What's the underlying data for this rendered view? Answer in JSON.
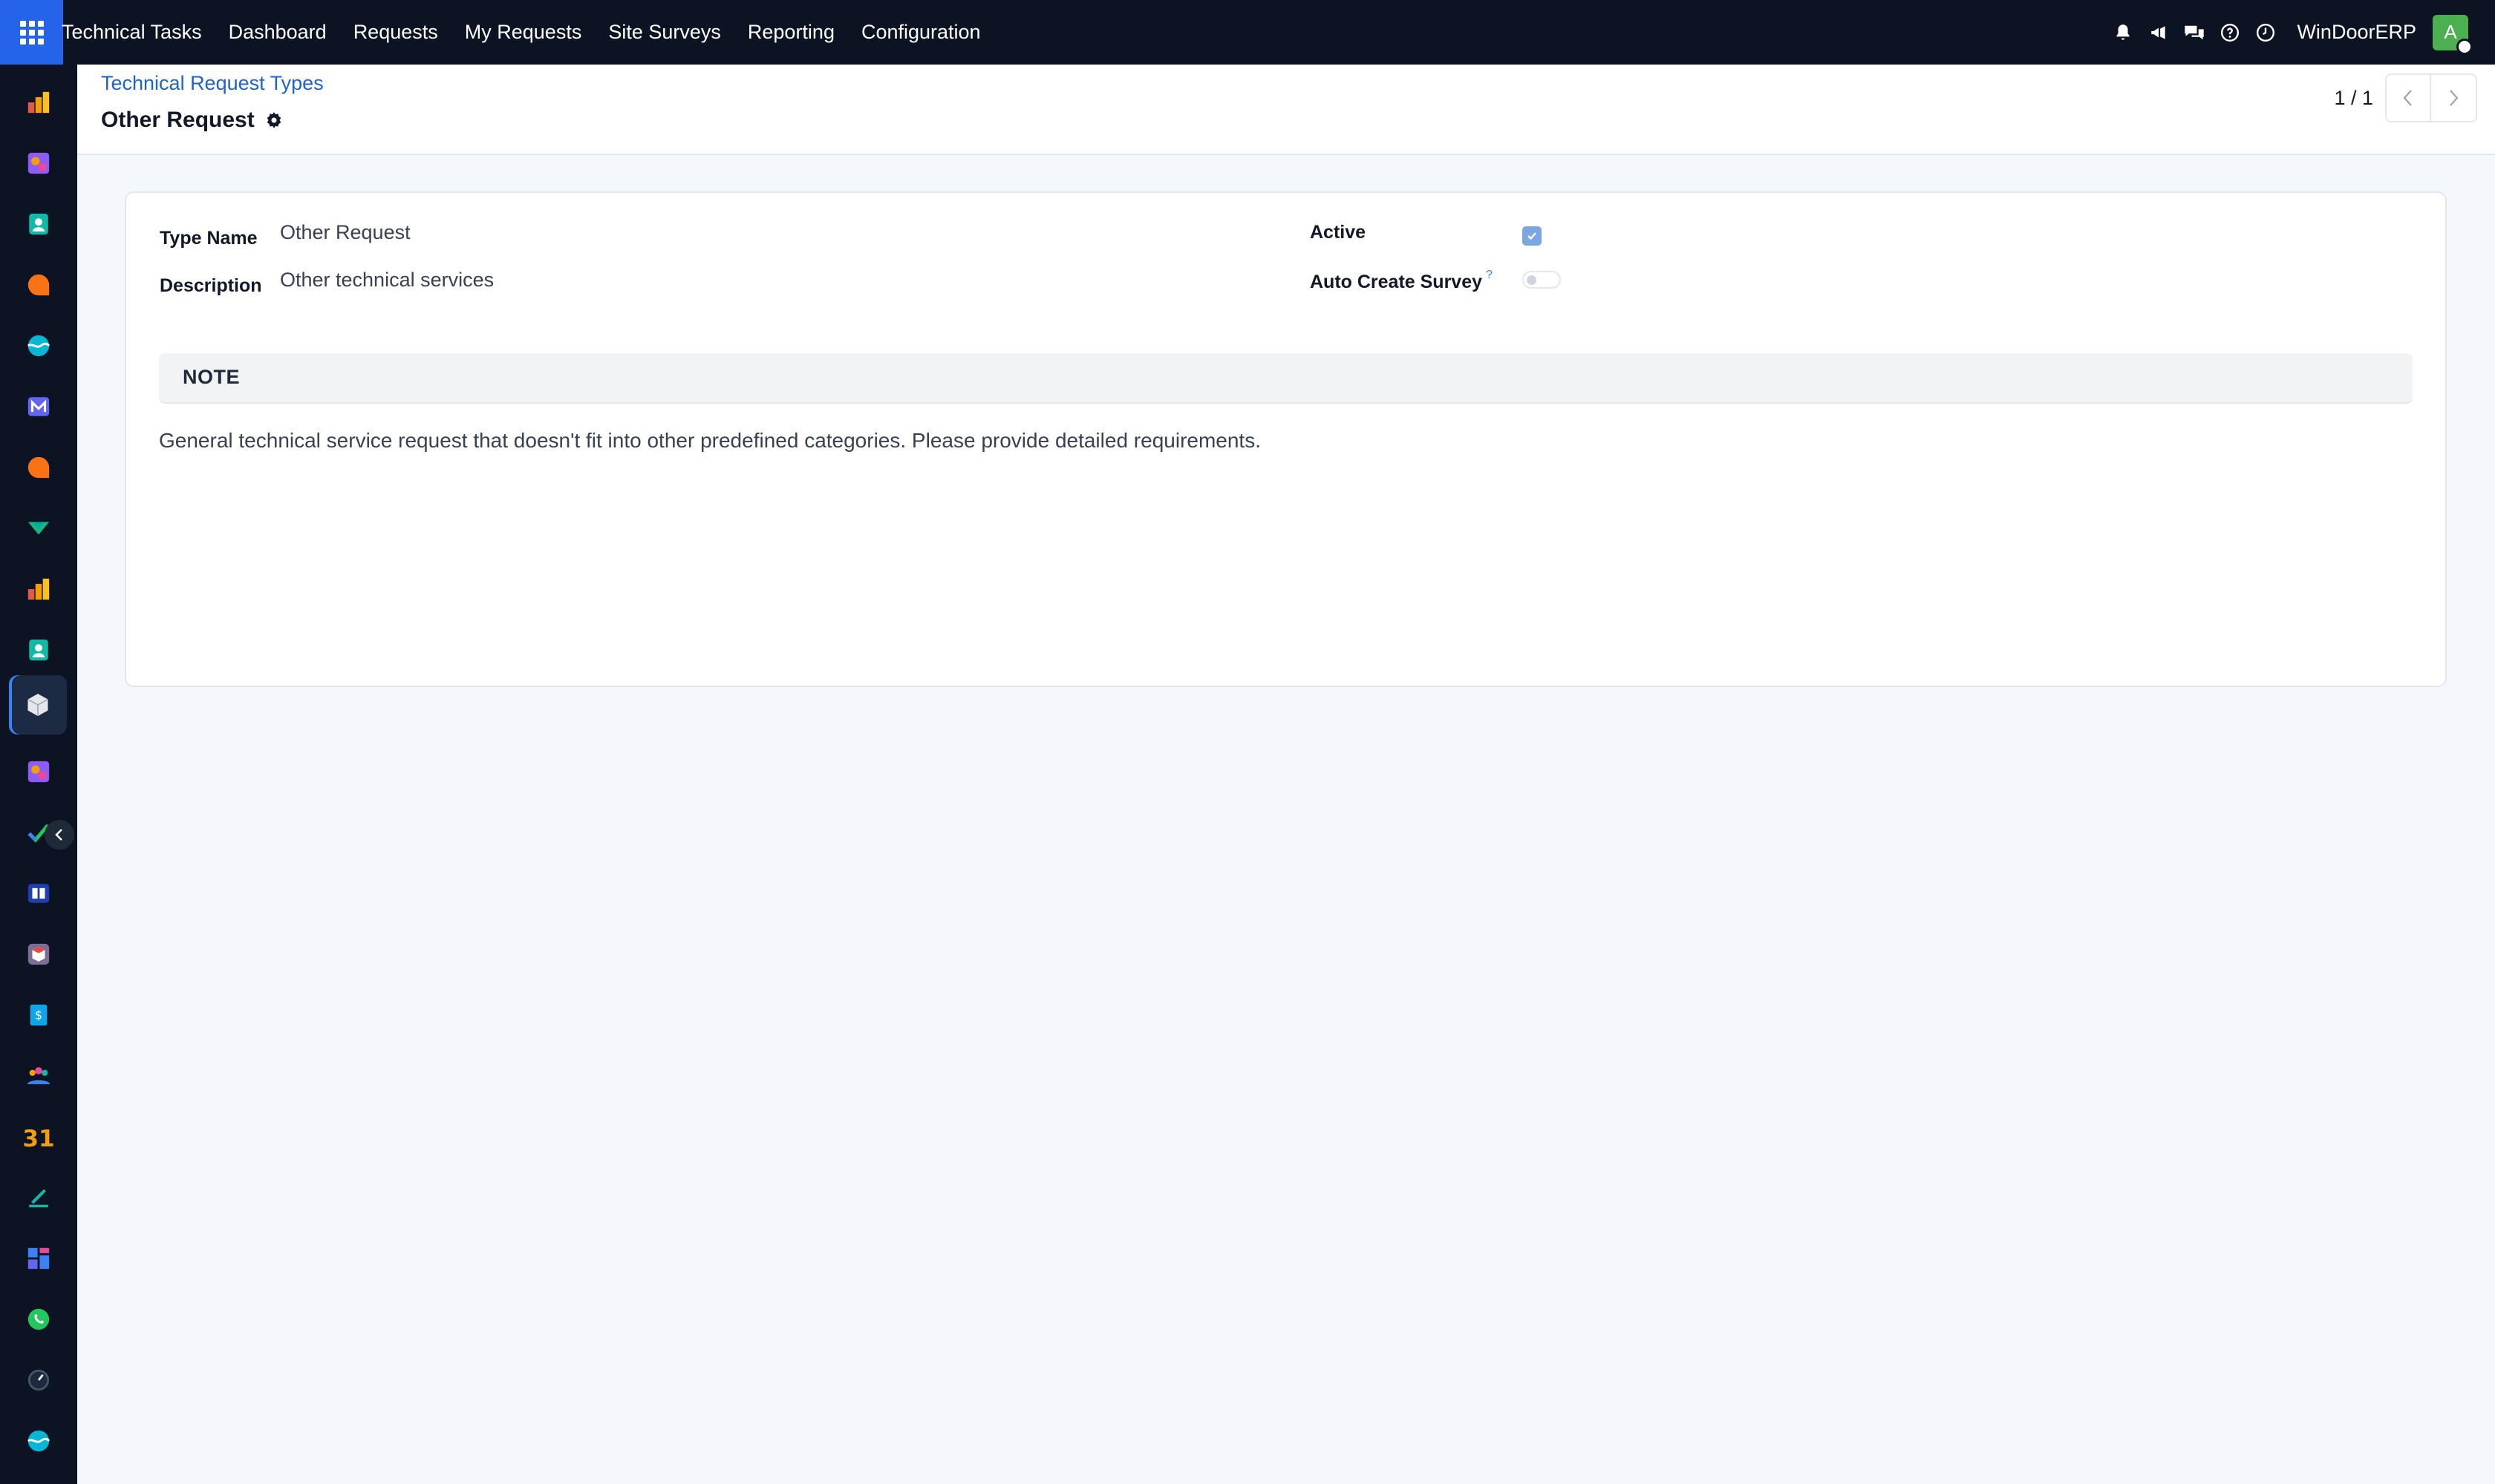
{
  "navbar": {
    "app_name": "Technical Tasks",
    "menu": [
      "Dashboard",
      "Requests",
      "My Requests",
      "Site Surveys",
      "Reporting",
      "Configuration"
    ],
    "company": "WinDoorERP",
    "avatar_letter": "A",
    "icons": [
      "bell-icon",
      "megaphone-icon",
      "chat-icon",
      "help-icon",
      "clock-icon"
    ]
  },
  "sidebar": {
    "apps": [
      "dashboards-app",
      "planning-app",
      "contacts-app",
      "discuss-app",
      "website-app",
      "mail-app",
      "livechat-app",
      "inventory-app",
      "sales-app",
      "employees-app",
      "technical-tasks-app",
      "planning-app-2",
      "project-app",
      "knowledge-app",
      "sign-app",
      "invoicing-app",
      "community-app",
      "calendar-app",
      "signature-app",
      "dashboard-app",
      "whatsapp-app",
      "clock-app",
      "website-app-2"
    ]
  },
  "control_panel": {
    "breadcrumb": "Technical Request Types",
    "title": "Other Request",
    "pager": "1 / 1"
  },
  "form": {
    "type_name_label": "Type Name",
    "type_name": "Other Request",
    "description_label": "Description",
    "description": "Other technical services",
    "active_label": "Active",
    "active": true,
    "auto_create_survey_label": "Auto Create Survey",
    "auto_create_survey_help": "?",
    "auto_create_survey": false,
    "note_title": "NOTE",
    "note": "General technical service request that doesn't fit into other predefined categories. Please provide detailed requirements."
  },
  "colors": {
    "navbar_bg": "#0c1322",
    "apps_button": "#2563eb",
    "link": "#1e63c7",
    "avatar": "#4caf50",
    "checkbox": "#7aa7e0"
  }
}
